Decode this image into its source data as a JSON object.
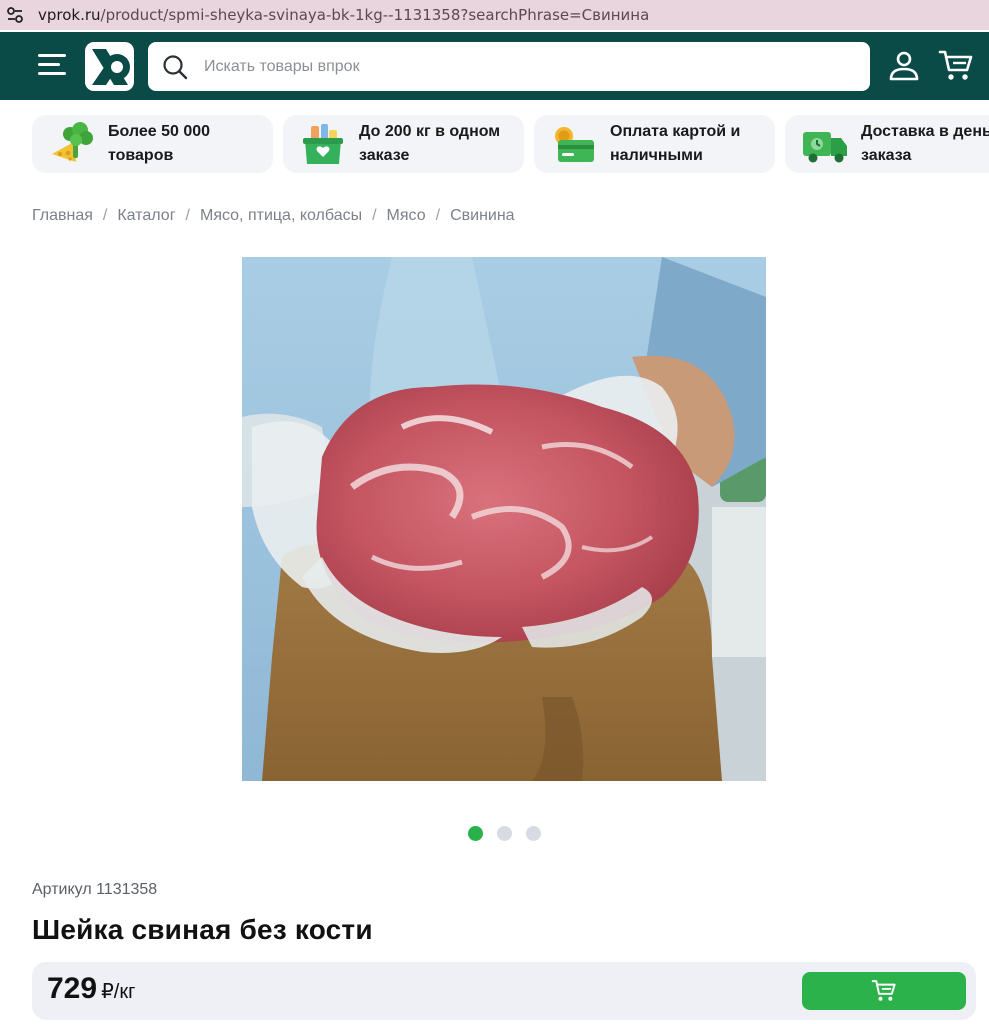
{
  "browser": {
    "url_host": "vprok.ru",
    "url_path": "/product/spmi-sheyka-svinaya-bk-1kg--1131358?searchPhrase=Свинина"
  },
  "header": {
    "search_placeholder": "Искать товары впрок"
  },
  "features": [
    {
      "text": "Более 50 000\nтоваров"
    },
    {
      "text": "До 200 кг в одном\nзаказе"
    },
    {
      "text": "Оплата картой и\nналичными"
    },
    {
      "text": "Доставка в день\nзаказа"
    }
  ],
  "breadcrumb": [
    "Главная",
    "Каталог",
    "Мясо, птица, колбасы",
    "Мясо",
    "Свинина"
  ],
  "product": {
    "article": "Артикул 1131358",
    "title": "Шейка свиная без кости",
    "price": "729",
    "price_unit": "₽/кг",
    "image_count": 3,
    "active_image": 1
  },
  "colors": {
    "header_bg": "#0a4a47",
    "accent_green": "#2cb24a",
    "card_bg": "#f3f4f7"
  }
}
